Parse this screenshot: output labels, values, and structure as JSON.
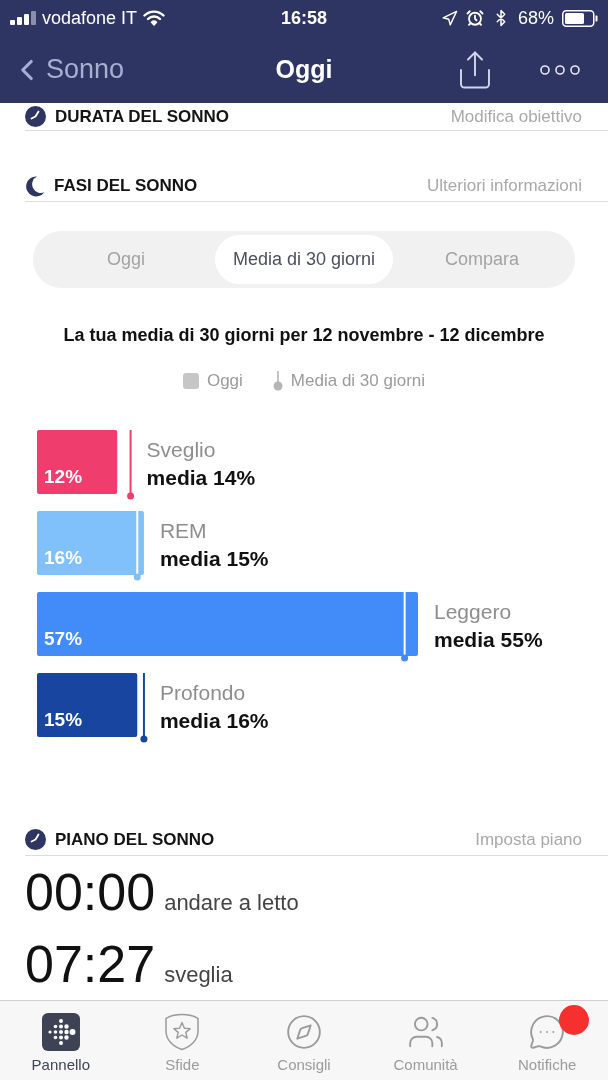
{
  "status_bar": {
    "carrier": "vodafone IT",
    "time": "16:58",
    "battery": "68%"
  },
  "nav_bar": {
    "back": "Sonno",
    "title": "Oggi"
  },
  "sleep_duration": {
    "title": "DURATA DEL SONNO",
    "link": "Modifica obiettivo"
  },
  "sleep_stages": {
    "title": "FASI DEL SONNO",
    "link": "Ulteriori informazioni",
    "segments": [
      {
        "label": "Oggi",
        "selected": false
      },
      {
        "label": "Media di 30 giorni",
        "selected": true
      },
      {
        "label": "Compara",
        "selected": false
      }
    ],
    "heading": "La tua media di 30 giorni per 12 novembre - 12 dicembre",
    "legend": [
      {
        "label": "Oggi",
        "kind": "bar"
      },
      {
        "label": "Media di 30 giorni",
        "kind": "marker"
      }
    ],
    "chart_data": {
      "type": "bar",
      "orientation": "horizontal",
      "categories": [
        "Sveglio",
        "REM",
        "Leggero",
        "Profondo"
      ],
      "values": [
        12,
        16,
        57,
        15
      ],
      "colors": [
        "#ef3e6d",
        "#80c1fb",
        "#418cf8",
        "#17459f"
      ],
      "value_labels": [
        "12%",
        "16%",
        "57%",
        "15%"
      ],
      "annotations": [
        "media 14%",
        "media 15%",
        "media 55%",
        "media 16%"
      ]
    }
  },
  "sleep_plan": {
    "title": "PIANO DEL SONNO",
    "link": "Imposta piano",
    "times": [
      {
        "time": "00:00",
        "label": "andare a letto"
      },
      {
        "time": "07:27",
        "label": "sveglia"
      }
    ]
  },
  "tab_bar": [
    {
      "label": "Pannello",
      "kind": "dashboard",
      "selected": true,
      "badge": false
    },
    {
      "label": "Sfide",
      "kind": "challenges",
      "selected": false,
      "badge": false
    },
    {
      "label": "Consigli",
      "kind": "tips",
      "selected": false,
      "badge": false
    },
    {
      "label": "Comunità",
      "kind": "community",
      "selected": false,
      "badge": false
    },
    {
      "label": "Notifiche",
      "kind": "notifications",
      "selected": false,
      "badge": true
    }
  ]
}
